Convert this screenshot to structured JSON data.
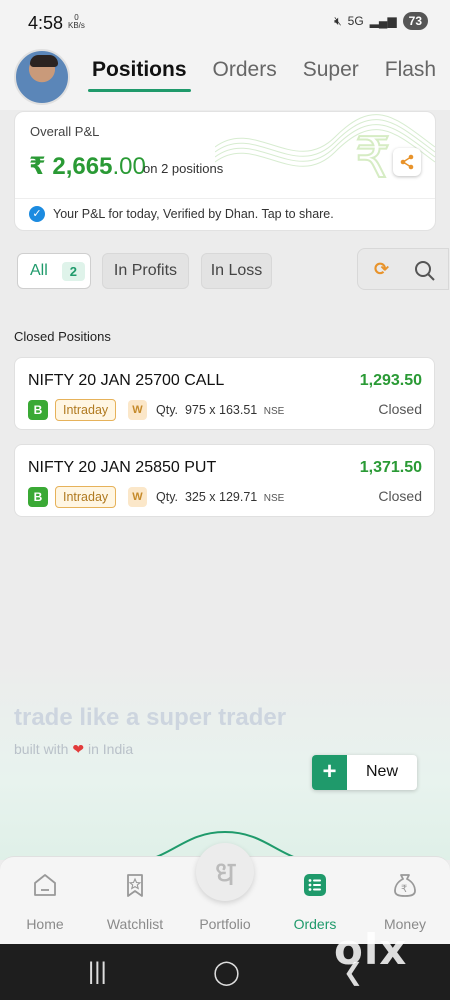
{
  "status_bar": {
    "time": "4:58",
    "net_speed": "0",
    "net_unit": "KB/s",
    "network": "5G",
    "battery": "73"
  },
  "header": {
    "tabs": [
      {
        "label": "Positions",
        "active": true
      },
      {
        "label": "Orders",
        "active": false
      },
      {
        "label": "Super",
        "active": false
      },
      {
        "label": "Flash",
        "active": false
      }
    ]
  },
  "pnl": {
    "title": "Overall P&L",
    "currency": "₹",
    "amount_int": "2,665",
    "amount_dec": ".00",
    "on_positions": "on 2 positions",
    "verify_text": "Your P&L for today, Verified by Dhan. Tap to share."
  },
  "filters": {
    "all_label": "All",
    "all_count": "2",
    "profits_label": "In Profits",
    "loss_label": "In Loss"
  },
  "section_title": "Closed Positions",
  "positions": [
    {
      "name": "NIFTY 20 JAN 25700 CALL",
      "value": "1,293.50",
      "status": "Closed",
      "side": "B",
      "product": "Intraday",
      "tag": "W",
      "qty_label": "Qty.",
      "qty": "975",
      "times": "x",
      "price": "163.51",
      "exchange": "NSE"
    },
    {
      "name": "NIFTY 20 JAN 25850 PUT",
      "value": "1,371.50",
      "status": "Closed",
      "side": "B",
      "product": "Intraday",
      "tag": "W",
      "qty_label": "Qty.",
      "qty": "325",
      "times": "x",
      "price": "129.71",
      "exchange": "NSE"
    }
  ],
  "promo": {
    "title": "trade like a super trader",
    "sub_before": "built with",
    "sub_after": "in India"
  },
  "new_button": {
    "label": "New"
  },
  "bottom_nav": [
    {
      "label": "Home",
      "icon": "home-icon",
      "active": false
    },
    {
      "label": "Watchlist",
      "icon": "watchlist-icon",
      "active": false
    },
    {
      "label": "Portfolio",
      "icon": "portfolio-icon",
      "active": false
    },
    {
      "label": "Orders",
      "icon": "orders-icon",
      "active": true
    },
    {
      "label": "Money",
      "icon": "money-icon",
      "active": false
    }
  ],
  "portfolio_glyph": "ध",
  "watermark": "olx",
  "colors": {
    "accent": "#1f9a6b",
    "profit": "#2a9a35",
    "intraday": "#e6b25a"
  }
}
